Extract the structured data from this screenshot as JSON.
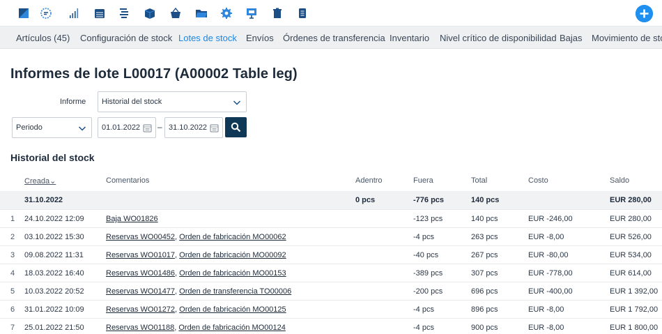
{
  "toolbar": {
    "icons": [
      "dashboard-icon",
      "settings-gear-icon",
      "signal-bars-icon",
      "calendar-grid-icon",
      "list-indent-icon",
      "box-icon",
      "basket-icon",
      "folder-icon",
      "gear-icon",
      "presentation-icon",
      "trash-icon",
      "document-icon"
    ],
    "accent_color": "#1f8ff0",
    "add_icon": "plus-circle-icon"
  },
  "nav": {
    "items": [
      "Artículos (45)",
      "Configuración de stock",
      "Lotes de stock",
      "Envíos",
      "Órdenes de transferencia",
      "Inventario",
      "Nivel crítico de disponibilidad",
      "Bajas",
      "Movimiento de sto"
    ],
    "active_index": 2,
    "active_color": "#1f86e0"
  },
  "page": {
    "title": "Informes de lote L00017 (A00002 Table leg)"
  },
  "form": {
    "report_label": "Informe",
    "report_value": "Historial del stock",
    "period_value": "Periodo",
    "date_from": "01.01.2022",
    "date_separator": "–",
    "date_to": "31.10.2022",
    "search_icon": "search-icon"
  },
  "section": {
    "title": "Historial del stock"
  },
  "table": {
    "headers": {
      "created": "Creada",
      "comments": "Comentarios",
      "in": "Adentro",
      "out": "Fuera",
      "total": "Total",
      "cost": "Costo",
      "balance": "Saldo"
    },
    "summary": {
      "date": "31.10.2022",
      "in": "0 pcs",
      "out": "-776 pcs",
      "total": "140 pcs",
      "balance": "EUR 280,00"
    },
    "rows": [
      {
        "n": "1",
        "date": "24.10.2022 12:09",
        "link1": "Baja WO01826",
        "sep": "",
        "link2": "",
        "out": "-123 pcs",
        "total": "140 pcs",
        "cost": "EUR -246,00",
        "balance": "EUR 280,00"
      },
      {
        "n": "2",
        "date": "03.10.2022 15:30",
        "link1": "Reservas WO00452",
        "sep": ",",
        "link2": "Orden de fabricación MO00062",
        "out": "-4 pcs",
        "total": "263 pcs",
        "cost": "EUR -8,00",
        "balance": "EUR 526,00"
      },
      {
        "n": "3",
        "date": "09.08.2022 11:31",
        "link1": "Reservas WO01017",
        "sep": ",",
        "link2": "Orden de fabricación MO00092",
        "out": "-40 pcs",
        "total": "267 pcs",
        "cost": "EUR -80,00",
        "balance": "EUR 534,00"
      },
      {
        "n": "4",
        "date": "18.03.2022 16:40",
        "link1": "Reservas WO01486",
        "sep": ",",
        "link2": "Orden de fabricación MO00153",
        "out": "-389 pcs",
        "total": "307 pcs",
        "cost": "EUR -778,00",
        "balance": "EUR 614,00"
      },
      {
        "n": "5",
        "date": "10.03.2022 20:52",
        "link1": "Reservas WO01477",
        "sep": ",",
        "link2": "Orden de transferencia TO00006",
        "out": "-200 pcs",
        "total": "696 pcs",
        "cost": "EUR -400,00",
        "balance": "EUR 1 392,00"
      },
      {
        "n": "6",
        "date": "31.01.2022 10:09",
        "link1": "Reservas WO01272",
        "sep": ",",
        "link2": "Orden de fabricación MO00125",
        "out": "-4 pcs",
        "total": "896 pcs",
        "cost": "EUR -8,00",
        "balance": "EUR 1 792,00"
      },
      {
        "n": "7",
        "date": "25.01.2022 21:50",
        "link1": "Reservas WO01188",
        "sep": ",",
        "link2": "Orden de fabricación MO00124",
        "out": "-4 pcs",
        "total": "900 pcs",
        "cost": "EUR -8,00",
        "balance": "EUR 1 800,00"
      }
    ]
  }
}
